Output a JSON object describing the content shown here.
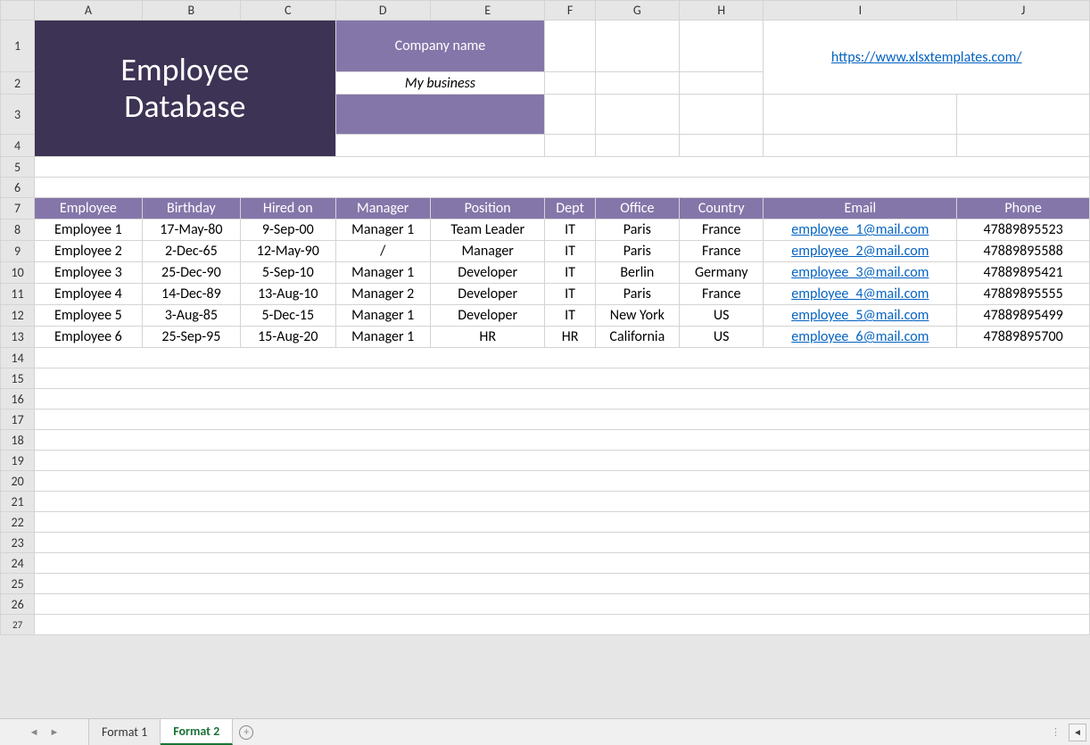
{
  "columns": {
    "A": "A",
    "B": "B",
    "C": "C",
    "D": "D",
    "E": "E",
    "F": "F",
    "G": "G",
    "H": "H",
    "I": "I",
    "J": "J"
  },
  "rows": {
    "r1": "1",
    "r2": "2",
    "r3": "3",
    "r4": "4",
    "r5": "5",
    "r6": "6",
    "r7": "7",
    "r8": "8",
    "r9": "9",
    "r10": "10",
    "r11": "11",
    "r12": "12",
    "r13": "13",
    "r14": "14",
    "r15": "15",
    "r16": "16",
    "r17": "17",
    "r18": "18",
    "r19": "19",
    "r20": "20",
    "r21": "21",
    "r22": "22",
    "r23": "23",
    "r24": "24",
    "r25": "25",
    "r26": "26",
    "r27": "27"
  },
  "title": {
    "line1": "Employee",
    "line2": "Database"
  },
  "company": {
    "label": "Company name",
    "value": "My business"
  },
  "link": {
    "text": "https://www.xlsxtemplates.com/"
  },
  "headers": {
    "employee": "Employee",
    "birthday": "Birthday",
    "hired": "Hired on",
    "manager": "Manager",
    "position": "Position",
    "dept": "Dept",
    "office": "Office",
    "country": "Country",
    "email": "Email",
    "phone": "Phone"
  },
  "data": [
    {
      "employee": "Employee 1",
      "birthday": "17-May-80",
      "hired": "9-Sep-00",
      "manager": "Manager 1",
      "position": "Team Leader",
      "dept": "IT",
      "office": "Paris",
      "country": "France",
      "email": "employee_1@mail.com",
      "phone": "47889895523"
    },
    {
      "employee": "Employee 2",
      "birthday": "2-Dec-65",
      "hired": "12-May-90",
      "manager": "/",
      "position": "Manager",
      "dept": "IT",
      "office": "Paris",
      "country": "France",
      "email": "employee_2@mail.com",
      "phone": "47889895588"
    },
    {
      "employee": "Employee 3",
      "birthday": "25-Dec-90",
      "hired": "5-Sep-10",
      "manager": "Manager 1",
      "position": "Developer",
      "dept": "IT",
      "office": "Berlin",
      "country": "Germany",
      "email": "employee_3@mail.com",
      "phone": "47889895421"
    },
    {
      "employee": "Employee 4",
      "birthday": "14-Dec-89",
      "hired": "13-Aug-10",
      "manager": "Manager 2",
      "position": "Developer",
      "dept": "IT",
      "office": "Paris",
      "country": "France",
      "email": "employee_4@mail.com",
      "phone": "47889895555"
    },
    {
      "employee": "Employee 5",
      "birthday": "3-Aug-85",
      "hired": "5-Dec-15",
      "manager": "Manager 1",
      "position": "Developer",
      "dept": "IT",
      "office": "New York",
      "country": "US",
      "email": "employee_5@mail.com",
      "phone": "47889895499"
    },
    {
      "employee": "Employee 6",
      "birthday": "25-Sep-95",
      "hired": "15-Aug-20",
      "manager": "Manager 1",
      "position": "HR",
      "dept": "HR",
      "office": "California",
      "country": "US",
      "email": "employee_6@mail.com",
      "phone": "47889895700"
    }
  ],
  "tabs": {
    "tab1": "Format 1",
    "tab2": "Format 2"
  }
}
